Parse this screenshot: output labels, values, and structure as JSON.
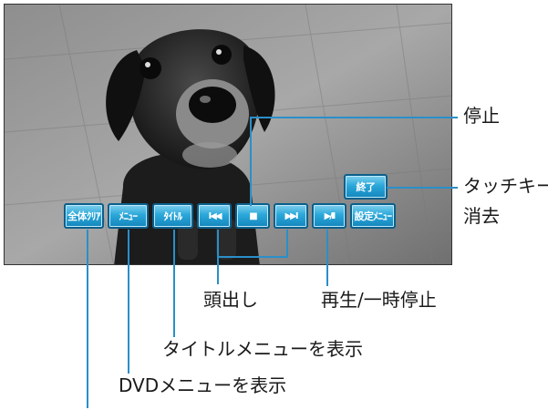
{
  "buttons": {
    "all_clear": "全体ｸﾘｱ",
    "menu": "ﾒﾆｭｰ",
    "title": "ﾀｲﾄﾙ",
    "prev_glyph": "I◀◀",
    "stop_glyph": "■",
    "next_glyph": "▶▶I",
    "play_pause_glyph": "▶/II",
    "settings": "設定ﾒﾆｭｰ",
    "end": "終了"
  },
  "labels": {
    "stop": "停止",
    "touch_key_erase_line1": "タッチキー",
    "touch_key_erase_line2": "消去",
    "chapter_jump": "頭出し",
    "play_pause": "再生/一時停止",
    "title_menu": "タイトルメニューを表示",
    "dvd_menu": "DVDメニューを表示"
  },
  "colors": {
    "button": "#2aa7d9",
    "callout_line": "#2a8fc9"
  }
}
